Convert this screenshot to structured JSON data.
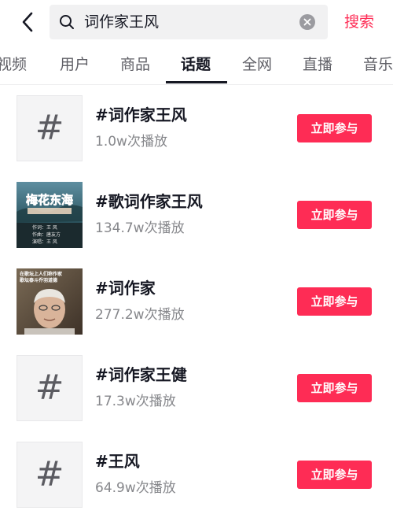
{
  "search": {
    "query": "词作家王风",
    "submit_label": "搜索"
  },
  "tabs": [
    {
      "label": "视频",
      "active": false
    },
    {
      "label": "用户",
      "active": false
    },
    {
      "label": "商品",
      "active": false
    },
    {
      "label": "话题",
      "active": true
    },
    {
      "label": "全网",
      "active": false
    },
    {
      "label": "直播",
      "active": false
    },
    {
      "label": "音乐",
      "active": false
    }
  ],
  "results": [
    {
      "title": "#词作家王风",
      "plays": "1.0w次播放",
      "thumb": "hash-icon",
      "action": "立即参与"
    },
    {
      "title": "#歌词作家王风",
      "plays": "134.7w次播放",
      "thumb": "image",
      "action": "立即参与"
    },
    {
      "title": "#词作家",
      "plays": "277.2w次播放",
      "thumb": "image",
      "action": "立即参与"
    },
    {
      "title": "#词作家王健",
      "plays": "17.3w次播放",
      "thumb": "hash-icon",
      "action": "立即参与"
    },
    {
      "title": "#王风",
      "plays": "64.9w次播放",
      "thumb": "hash-icon",
      "action": "立即参与"
    }
  ],
  "thumb_text": {
    "result_1": {
      "title": "梅花东海",
      "lines": [
        "作词：王 风",
        "作曲：唐友方",
        "演唱：王 风"
      ]
    },
    "result_2": {
      "lines": [
        "在歌坛上人们称作家",
        "歌坛泰斗乔羽道德"
      ]
    }
  },
  "colors": {
    "accent": "#fe2c55",
    "text_primary": "#161823",
    "text_secondary": "#86878b",
    "search_bg": "#f1f1f2"
  }
}
